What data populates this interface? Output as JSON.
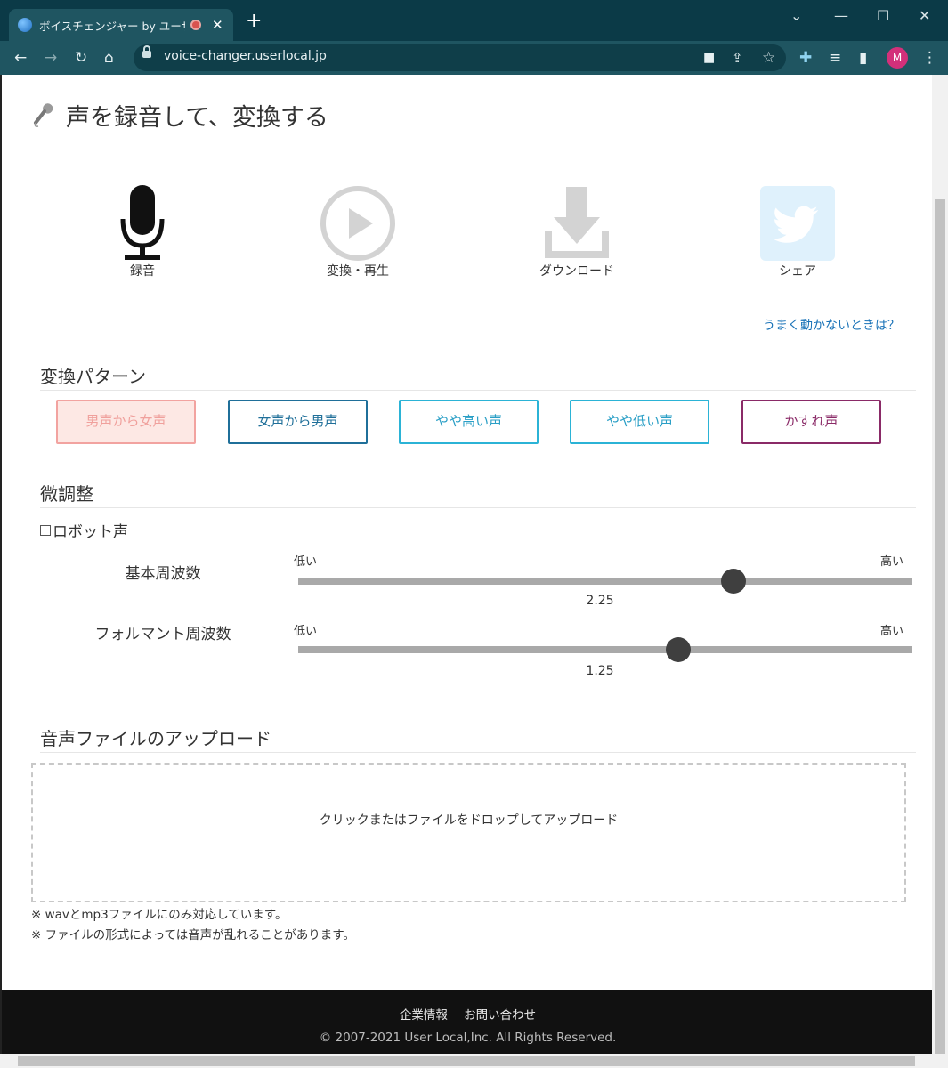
{
  "browser": {
    "tab_title": "ボイスチェンジャー by ユーザーローカル",
    "url": "voice-changer.userlocal.jp",
    "avatar_letter": "M",
    "colors": {
      "tabbar": "#0b3a47",
      "toolbar": "#1f5561",
      "avatar": "#d3307a"
    }
  },
  "page": {
    "title": "声を録音して、変換する",
    "actions": [
      {
        "label": "録音",
        "icon": "microphone-icon"
      },
      {
        "label": "変換・再生",
        "icon": "play-icon"
      },
      {
        "label": "ダウンロード",
        "icon": "download-icon"
      },
      {
        "label": "シェア",
        "icon": "twitter-icon"
      }
    ],
    "help_link": "うまく動かないときは？",
    "pattern_section": {
      "title": "変換パターン",
      "buttons": [
        "男声から女声",
        "女声から男声",
        "やや高い声",
        "やや低い声",
        "かすれ声"
      ],
      "selected_index": 0
    },
    "tuning_section": {
      "title": "微調整",
      "robot_label": "ロボット声",
      "robot_checked": false,
      "sliders": [
        {
          "label": "基本周波数",
          "low": "低い",
          "high": "高い",
          "value": "2.25",
          "fraction": 0.71
        },
        {
          "label": "フォルマント周波数",
          "low": "低い",
          "high": "高い",
          "value": "1.25",
          "fraction": 0.62
        }
      ]
    },
    "upload_section": {
      "title": "音声ファイルのアップロード",
      "dropzone_text": "クリックまたはファイルをドロップしてアップロード",
      "notes": [
        "※ wavとmp3ファイルにのみ対応しています。",
        "※ ファイルの形式によっては音声が乱れることがあります。"
      ]
    },
    "footer": {
      "links": [
        "企業情報",
        "お問い合わせ"
      ],
      "copyright": "© 2007-2021 User Local,Inc. All Rights Reserved."
    }
  }
}
